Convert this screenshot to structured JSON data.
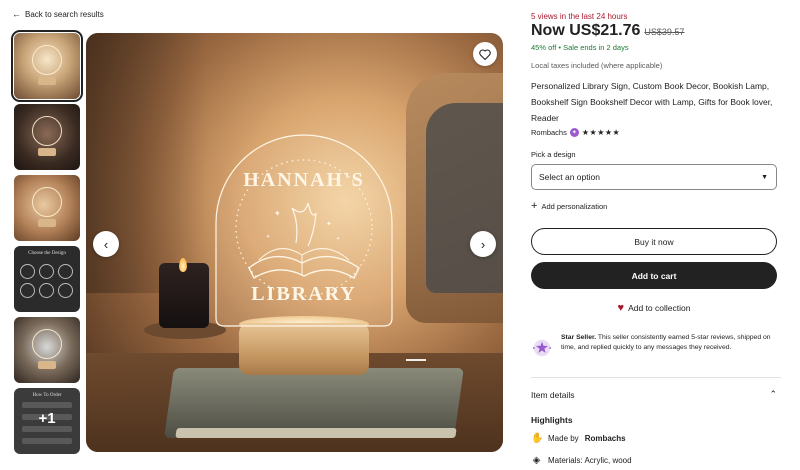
{
  "back_link": {
    "label": "Back to search results",
    "icon": "arrow-left-icon"
  },
  "thumbnails": {
    "count_overlay": "+1",
    "choose_design_caption": "Choose the Design",
    "how_to_order_caption": "How To Order"
  },
  "main_image": {
    "lamp_text_top": "HANNAH'S",
    "lamp_text_bottom": "LIBRARY"
  },
  "product": {
    "views": "5 views in the last 24 hours",
    "price_now": "Now US$21.76",
    "price_old": "US$39.57",
    "discount": "45% off",
    "sale_ends": "• Sale ends in 2 days",
    "taxes": "Local taxes included (where applicable)",
    "title": "Personalized Library Sign, Custom Book Decor, Bookish Lamp, Bookshelf Sign Bookshelf Decor with Lamp, Gifts for Book lover, Reader",
    "shop_name": "Rombachs",
    "stars": "★★★★★",
    "pick_label": "Pick a design",
    "select_value": "Select an option",
    "personalization_label": "Add personalization",
    "buy_label": "Buy it now",
    "cart_label": "Add to cart",
    "collection_label": "Add to collection"
  },
  "star_seller": {
    "title": "Star Seller.",
    "text": "This seller consistently earned 5-star reviews, shipped on time, and replied quickly to any messages they received."
  },
  "item_details": {
    "label": "Item details",
    "highlights_label": "Highlights",
    "made_by_prefix": "Made by",
    "made_by_shop": "Rombachs",
    "materials": "Materials: Acrylic, wood"
  },
  "colors": {
    "sale_green": "#1f7a35",
    "views_red": "#a61a2e",
    "button_dark": "#222222",
    "star_seller_purple": "#9b59d0"
  }
}
